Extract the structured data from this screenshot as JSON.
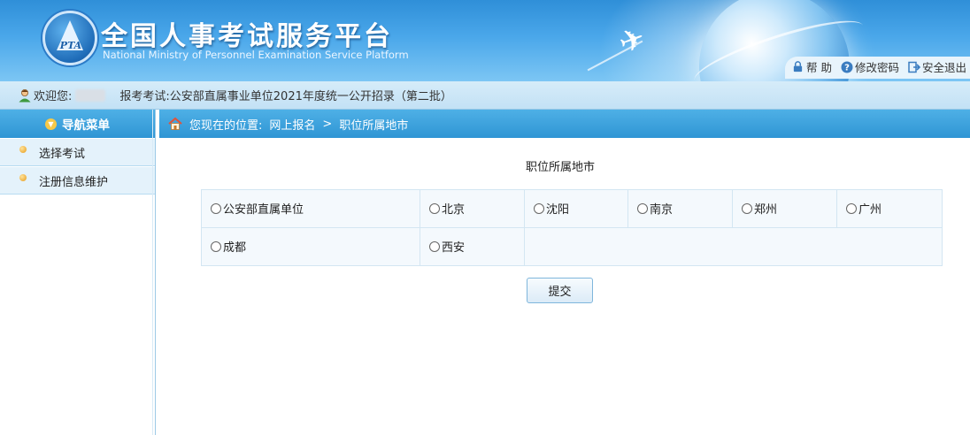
{
  "header": {
    "title": "全国人事考试服务平台",
    "subtitle": "National Ministry of Personnel Examination Service Platform",
    "logo_text": "PTA",
    "links": [
      {
        "label": "帮 助",
        "icon": "lock-icon"
      },
      {
        "label": "修改密码",
        "icon": "question-icon"
      },
      {
        "label": "安全退出",
        "icon": "exit-icon"
      }
    ]
  },
  "welcome": {
    "greeting": "欢迎您:",
    "exam_label": "报考考试:",
    "exam_name": "公安部直属事业单位2021年度统一公开招录（第二批）"
  },
  "sidebar": {
    "header": "导航菜单",
    "items": [
      {
        "label": "选择考试"
      },
      {
        "label": "注册信息维护"
      }
    ]
  },
  "breadcrumb": {
    "prefix": "您现在的位置:",
    "parent": "网上报名",
    "separator": ">",
    "current": "职位所属地市"
  },
  "main": {
    "section_title": "职位所属地市",
    "cities": [
      "公安部直属单位",
      "北京",
      "沈阳",
      "南京",
      "郑州",
      "广州",
      "成都",
      "西安"
    ],
    "submit_label": "提交"
  },
  "colors": {
    "header_blue": "#2f8fd8",
    "nav_blue": "#2f95d4",
    "welcome_bar": "#c3e1f5",
    "table_cell": "#f4f9fd"
  }
}
